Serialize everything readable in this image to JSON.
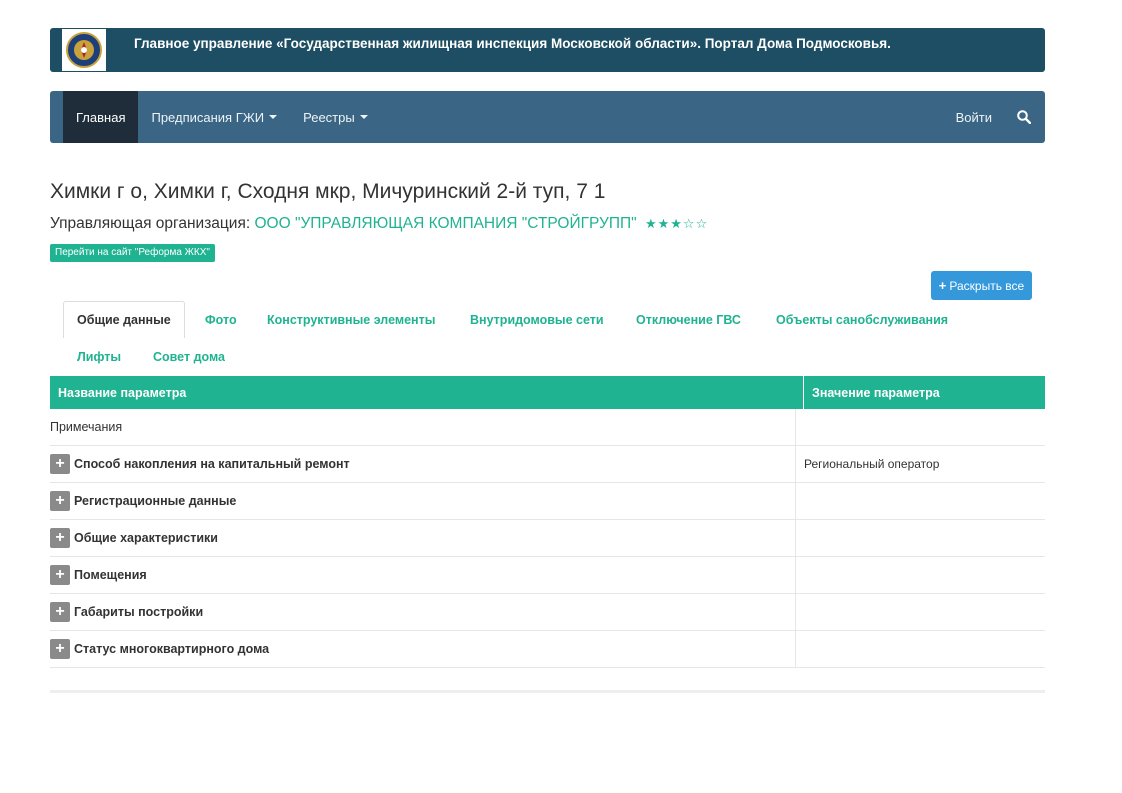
{
  "header": {
    "title": "Главное управление «Государственная жилищная инспекция Московской области». Портал Дома Подмосковья.",
    "logo_icon": "coat-of-arms-emblem"
  },
  "navbar": {
    "home": "Главная",
    "prescriptions": "Предписания ГЖИ",
    "registries": "Реестры",
    "login": "Войти",
    "search_icon": "search-icon"
  },
  "house": {
    "address": "Химки г о, Химки г, Сходня мкр, Мичуринский 2-й туп, 7 1",
    "org_label": "Управляющая организация:",
    "org_name": "ООО \"УПРАВЛЯЮЩАЯ КОМПАНИЯ \"СТРОЙГРУПП\"",
    "rating_stars": "★★★☆☆",
    "rating_value": 3,
    "reform_button": "Перейти на сайт \"Реформа ЖКХ\"",
    "expand_all_button": "Раскрыть все"
  },
  "tabs": [
    "Общие данные",
    "Фото",
    "Конструктивные элементы",
    "Внутридомовые сети",
    "Отключение ГВС",
    "Объекты санобслуживания",
    "Лифты",
    "Совет дома"
  ],
  "table": {
    "col_name": "Название параметра",
    "col_value": "Значение параметра",
    "notes": "Примечания",
    "rows": [
      {
        "name": "Способ накопления на капитальный ремонт",
        "value": "Региональный оператор"
      },
      {
        "name": "Регистрационные данные",
        "value": ""
      },
      {
        "name": "Общие характеристики",
        "value": ""
      },
      {
        "name": "Помещения",
        "value": ""
      },
      {
        "name": "Габариты постройки",
        "value": ""
      },
      {
        "name": "Статус многоквартирного дома",
        "value": ""
      }
    ]
  },
  "colors": {
    "banner": "#1d4e63",
    "navbar": "#3a6584",
    "accent": "#1fb391",
    "button_blue": "#3498db"
  }
}
